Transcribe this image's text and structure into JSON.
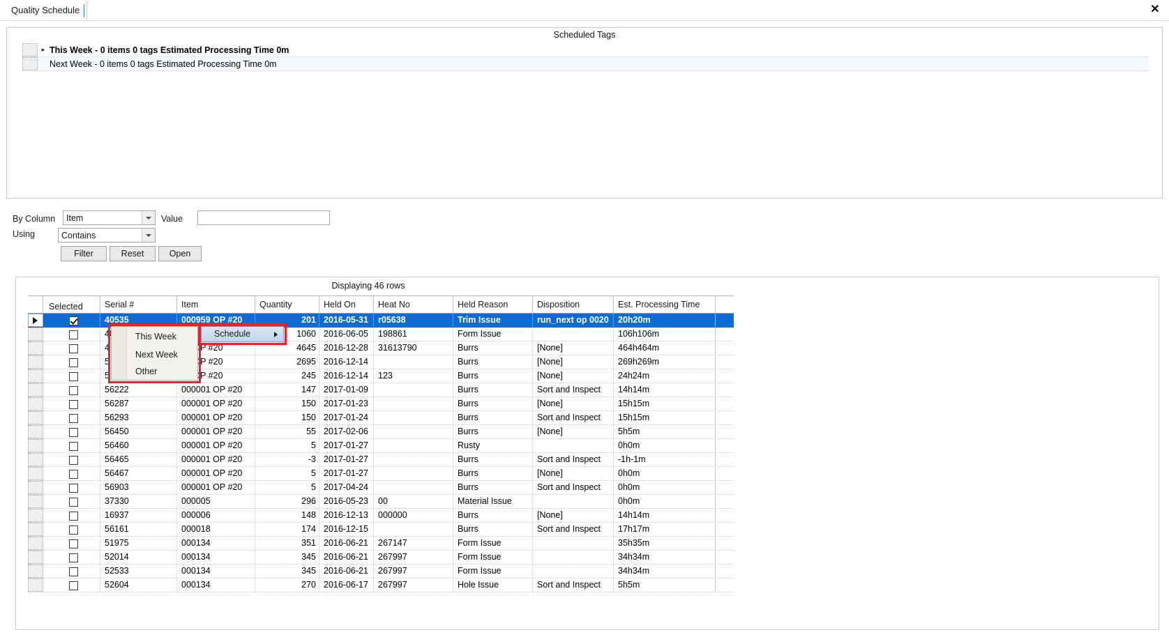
{
  "window": {
    "tab_title": "Quality Schedule",
    "close_label": "✕"
  },
  "top_panel": {
    "caption": "Scheduled Tags",
    "rows": [
      {
        "label": "This Week - 0 items 0 tags  Estimated Processing Time 0m",
        "expander": "▸"
      },
      {
        "label": "Next Week - 0 items 0 tags  Estimated Processing Time 0m",
        "expander": ""
      }
    ]
  },
  "filter": {
    "by_column_label": "By Column",
    "by_column_value": "Item",
    "using_label": "Using",
    "using_value": "Contains",
    "value_label": "Value",
    "value_text": "",
    "value_placeholder": "",
    "buttons": {
      "filter": "Filter",
      "reset": "Reset",
      "open": "Open"
    }
  },
  "grid": {
    "caption": "Displaying 46 rows",
    "columns": [
      "Selected",
      "Serial #",
      "Item",
      "Quantity",
      "Held On",
      "Heat No",
      "Held Reason",
      "Disposition",
      "Est. Processing Time"
    ],
    "rows": [
      {
        "selected": true,
        "serial": "40535",
        "item": "000959 OP #20",
        "quantity": "201",
        "held_on": "2016-05-31",
        "heat_no": "r05638",
        "held_reason": "Trim Issue",
        "disposition": "run_next op 0020",
        "est": "20h20m",
        "active": true
      },
      {
        "selected": false,
        "serial": "40",
        "item": "",
        "quantity": "1060",
        "held_on": "2016-06-05",
        "heat_no": "198861",
        "held_reason": "Form Issue",
        "disposition": "",
        "est": "106h106m",
        "active": false
      },
      {
        "selected": false,
        "serial": "4",
        "item": "43 OP #20",
        "quantity": "4645",
        "held_on": "2016-12-28",
        "heat_no": "31613790",
        "held_reason": "Burrs",
        "disposition": "[None]",
        "est": "464h464m",
        "active": false
      },
      {
        "selected": false,
        "serial": "5",
        "item": "40 OP #20",
        "quantity": "2695",
        "held_on": "2016-12-14",
        "heat_no": "",
        "held_reason": "Burrs",
        "disposition": "[None]",
        "est": "269h269m",
        "active": false
      },
      {
        "selected": false,
        "serial": "5",
        "item": "02 OP #20",
        "quantity": "245",
        "held_on": "2016-12-14",
        "heat_no": "123",
        "held_reason": "Burrs",
        "disposition": "[None]",
        "est": "24h24m",
        "active": false
      },
      {
        "selected": false,
        "serial": "56222",
        "item": "000001 OP #20",
        "quantity": "147",
        "held_on": "2017-01-09",
        "heat_no": "",
        "held_reason": "Burrs",
        "disposition": "Sort and Inspect",
        "est": "14h14m",
        "active": false
      },
      {
        "selected": false,
        "serial": "56287",
        "item": "000001 OP #20",
        "quantity": "150",
        "held_on": "2017-01-23",
        "heat_no": "",
        "held_reason": "Burrs",
        "disposition": "[None]",
        "est": "15h15m",
        "active": false
      },
      {
        "selected": false,
        "serial": "56293",
        "item": "000001 OP #20",
        "quantity": "150",
        "held_on": "2017-01-24",
        "heat_no": "",
        "held_reason": "Burrs",
        "disposition": "Sort and Inspect",
        "est": "15h15m",
        "active": false
      },
      {
        "selected": false,
        "serial": "56450",
        "item": "000001 OP #20",
        "quantity": "55",
        "held_on": "2017-02-06",
        "heat_no": "",
        "held_reason": "Burrs",
        "disposition": "[None]",
        "est": "5h5m",
        "active": false
      },
      {
        "selected": false,
        "serial": "56460",
        "item": "000001 OP #20",
        "quantity": "5",
        "held_on": "2017-01-27",
        "heat_no": "",
        "held_reason": "Rusty",
        "disposition": "",
        "est": "0h0m",
        "active": false
      },
      {
        "selected": false,
        "serial": "56465",
        "item": "000001 OP #20",
        "quantity": "-3",
        "held_on": "2017-01-27",
        "heat_no": "",
        "held_reason": "Burrs",
        "disposition": "Sort and Inspect",
        "est": "-1h-1m",
        "active": false
      },
      {
        "selected": false,
        "serial": "56467",
        "item": "000001 OP #20",
        "quantity": "5",
        "held_on": "2017-01-27",
        "heat_no": "",
        "held_reason": "Burrs",
        "disposition": "[None]",
        "est": "0h0m",
        "active": false
      },
      {
        "selected": false,
        "serial": "56903",
        "item": "000001 OP #20",
        "quantity": "5",
        "held_on": "2017-04-24",
        "heat_no": "",
        "held_reason": "Burrs",
        "disposition": "Sort and Inspect",
        "est": "0h0m",
        "active": false
      },
      {
        "selected": false,
        "serial": "37330",
        "item": "000005",
        "quantity": "296",
        "held_on": "2016-05-23",
        "heat_no": "00",
        "held_reason": "Material Issue",
        "disposition": "",
        "est": "0h0m",
        "active": false
      },
      {
        "selected": false,
        "serial": "16937",
        "item": "000006",
        "quantity": "148",
        "held_on": "2016-12-13",
        "heat_no": "000000",
        "held_reason": "Burrs",
        "disposition": "[None]",
        "est": "14h14m",
        "active": false
      },
      {
        "selected": false,
        "serial": "56161",
        "item": "000018",
        "quantity": "174",
        "held_on": "2016-12-15",
        "heat_no": "",
        "held_reason": "Burrs",
        "disposition": "Sort and Inspect",
        "est": "17h17m",
        "active": false
      },
      {
        "selected": false,
        "serial": "51975",
        "item": "000134",
        "quantity": "351",
        "held_on": "2016-06-21",
        "heat_no": "267147",
        "held_reason": "Form Issue",
        "disposition": "",
        "est": "35h35m",
        "active": false
      },
      {
        "selected": false,
        "serial": "52014",
        "item": "000134",
        "quantity": "345",
        "held_on": "2016-06-21",
        "heat_no": "267997",
        "held_reason": "Form Issue",
        "disposition": "",
        "est": "34h34m",
        "active": false
      },
      {
        "selected": false,
        "serial": "52533",
        "item": "000134",
        "quantity": "345",
        "held_on": "2016-06-21",
        "heat_no": "267997",
        "held_reason": "Form Issue",
        "disposition": "",
        "est": "34h34m",
        "active": false
      },
      {
        "selected": false,
        "serial": "52604",
        "item": "000134",
        "quantity": "270",
        "held_on": "2016-06-17",
        "heat_no": "267997",
        "held_reason": "Hole Issue",
        "disposition": "Sort and Inspect",
        "est": "5h5m",
        "active": false
      }
    ]
  },
  "context_menu": {
    "schedule_label": "Schedule",
    "submenu_items": [
      "This Week",
      "Next Week",
      "Other"
    ],
    "highlight_color": "#ee2222"
  }
}
